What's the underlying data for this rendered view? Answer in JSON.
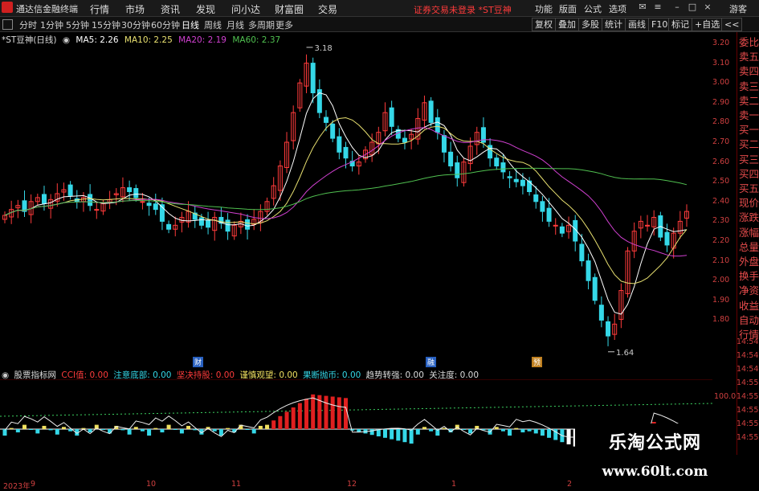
{
  "app": {
    "name": "通达信金融终端"
  },
  "menu": [
    "行情",
    "市场",
    "资讯",
    "发现",
    "问小达",
    "财富圈",
    "交易"
  ],
  "alert_text": "证券交易未登录 *ST豆神",
  "right_menu": [
    "功能",
    "版面",
    "公式",
    "选项",
    "游客"
  ],
  "window_controls": {
    "minimize": "–",
    "maximize": "□",
    "close": "×"
  },
  "timeframes": [
    "分时",
    "1分钟",
    "5分钟",
    "15分钟",
    "30分钟",
    "60分钟",
    "日线",
    "周线",
    "月线",
    "多周期",
    "更多"
  ],
  "active_timeframe": "日线",
  "tool_buttons": [
    "复权",
    "叠加",
    "多股",
    "统计",
    "画线",
    "F10",
    "标记",
    "+自选",
    "<<"
  ],
  "legend": {
    "title": "*ST豆神(日线)",
    "ma5": "MA5: 2.26",
    "ma10": "MA10: 2.25",
    "ma20": "MA20: 2.19",
    "ma60": "MA60: 2.37"
  },
  "annotations": {
    "high": "3.18",
    "low": "1.64"
  },
  "event_markers": [
    "财",
    "融",
    "预"
  ],
  "right_panel": [
    "委比",
    "卖五",
    "卖四",
    "卖三",
    "卖二",
    "卖一",
    "买一",
    "买二",
    "买三",
    "买四",
    "买五",
    "现价",
    "涨跌",
    "涨幅",
    "总量",
    "外盘",
    "换手",
    "净资",
    "收益",
    "自动",
    "行情"
  ],
  "y_ticks": [
    "3.20",
    "3.10",
    "3.00",
    "2.90",
    "2.80",
    "2.70",
    "2.60",
    "2.50",
    "2.40",
    "2.30",
    "2.20",
    "2.10",
    "2.00",
    "1.90",
    "1.80"
  ],
  "time_ticks": [
    "14:54",
    "14:54",
    "14:54",
    "14:55",
    "14:55",
    "14:55",
    "14:55",
    "14:55"
  ],
  "indicator": {
    "name": "股票指标网",
    "cci": "CCI值: 0.00",
    "bottom": "注意底部: 0.00",
    "hold": "坚决持股: 0.00",
    "cautious": "谨慎观望: 0.00",
    "sell": "果断抛币: 0.00",
    "trend": "趋势转强: 0.00",
    "attention": "关注度: 0.00",
    "level": "100.0"
  },
  "x_ticks": [
    "2023年",
    "9",
    "10",
    "11",
    "12",
    "1",
    "2"
  ],
  "watermark": {
    "title": "乐淘公式网",
    "url": "www.60lt.com"
  },
  "colors": {
    "up": "#ff3b3b",
    "down": "#35d8e8",
    "ma5": "#ffffff",
    "ma10": "#e8e070",
    "ma20": "#d040d0",
    "ma60": "#50c050"
  },
  "chart_data": {
    "type": "candlestick",
    "closes": [
      2.33,
      2.36,
      2.38,
      2.35,
      2.4,
      2.42,
      2.39,
      2.41,
      2.44,
      2.46,
      2.43,
      2.4,
      2.42,
      2.38,
      2.36,
      2.39,
      2.41,
      2.44,
      2.47,
      2.45,
      2.42,
      2.4,
      2.38,
      2.36,
      2.3,
      2.26,
      2.28,
      2.32,
      2.35,
      2.31,
      2.28,
      2.27,
      2.32,
      2.29,
      2.25,
      2.28,
      2.3,
      2.26,
      2.31,
      2.35,
      2.4,
      2.48,
      2.58,
      2.7,
      2.85,
      3.0,
      3.1,
      2.95,
      2.85,
      2.8,
      2.72,
      2.65,
      2.62,
      2.58,
      2.6,
      2.66,
      2.7,
      2.75,
      2.85,
      2.78,
      2.72,
      2.7,
      2.74,
      2.82,
      2.9,
      2.8,
      2.75,
      2.65,
      2.58,
      2.52,
      2.6,
      2.68,
      2.75,
      2.7,
      2.62,
      2.58,
      2.55,
      2.52,
      2.5,
      2.48,
      2.45,
      2.4,
      2.35,
      2.3,
      2.28,
      2.24,
      2.28,
      2.2,
      2.1,
      2.0,
      1.9,
      1.8,
      1.72,
      1.78,
      1.95,
      2.15,
      2.25,
      2.3,
      2.28,
      2.32,
      2.22,
      2.18,
      2.24,
      2.3,
      2.35
    ]
  }
}
